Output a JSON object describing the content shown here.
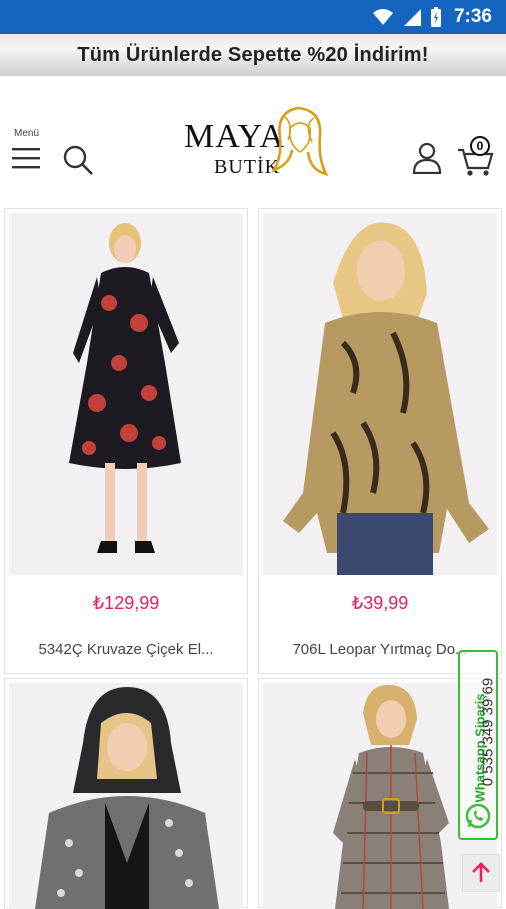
{
  "status_bar": {
    "time": "7:36"
  },
  "promo_banner": {
    "text": "Tüm Ürünlerde Sepette %20 İndirim!"
  },
  "header": {
    "menu_label": "Menü",
    "logo": {
      "line1": "MAYA",
      "line2": "BUTİK"
    },
    "cart_count": "0"
  },
  "products": [
    {
      "price": "₺129,99",
      "name": "5342Ç Kruvaze Çiçek El..."
    },
    {
      "price": "₺39,99",
      "name": "706L Leopar Yırtmaç Do..."
    },
    {
      "price": "",
      "name": ""
    },
    {
      "price": "",
      "name": ""
    }
  ],
  "whatsapp": {
    "label": "Whatsapp Sipariş",
    "phone": "0 535 349 39 69"
  },
  "colors": {
    "status_bar": "#1565c0",
    "price": "#e91e63",
    "whatsapp": "#3dbb3d",
    "scroll_top_arrow": "#e91e63"
  }
}
